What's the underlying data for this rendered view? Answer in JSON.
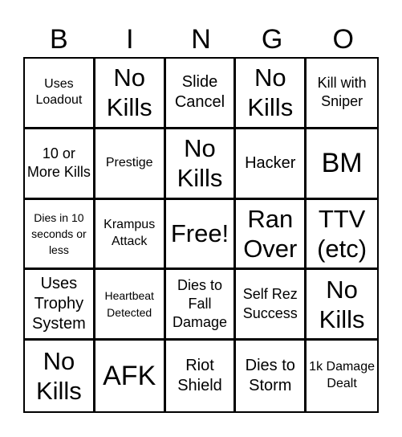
{
  "header": {
    "letters": [
      "B",
      "I",
      "N",
      "G",
      "O"
    ]
  },
  "board": {
    "cells": [
      [
        "Uses Loadout",
        "No Kills",
        "Slide Cancel",
        "No Kills",
        "Kill with Sniper"
      ],
      [
        "10 or More Kills",
        "Prestige",
        "No Kills",
        "Hacker",
        "BM"
      ],
      [
        "Dies in 10 seconds or less",
        "Krampus Attack",
        "Free!",
        "Ran Over",
        "TTV (etc)"
      ],
      [
        "Uses Trophy System",
        "Heartbeat Detected",
        "Dies to Fall Damage",
        "Self Rez Success",
        "No Kills"
      ],
      [
        "No Kills",
        "AFK",
        "Riot Shield",
        "Dies to Storm",
        "1k Damage Dealt"
      ]
    ],
    "free_space": "Free!"
  }
}
